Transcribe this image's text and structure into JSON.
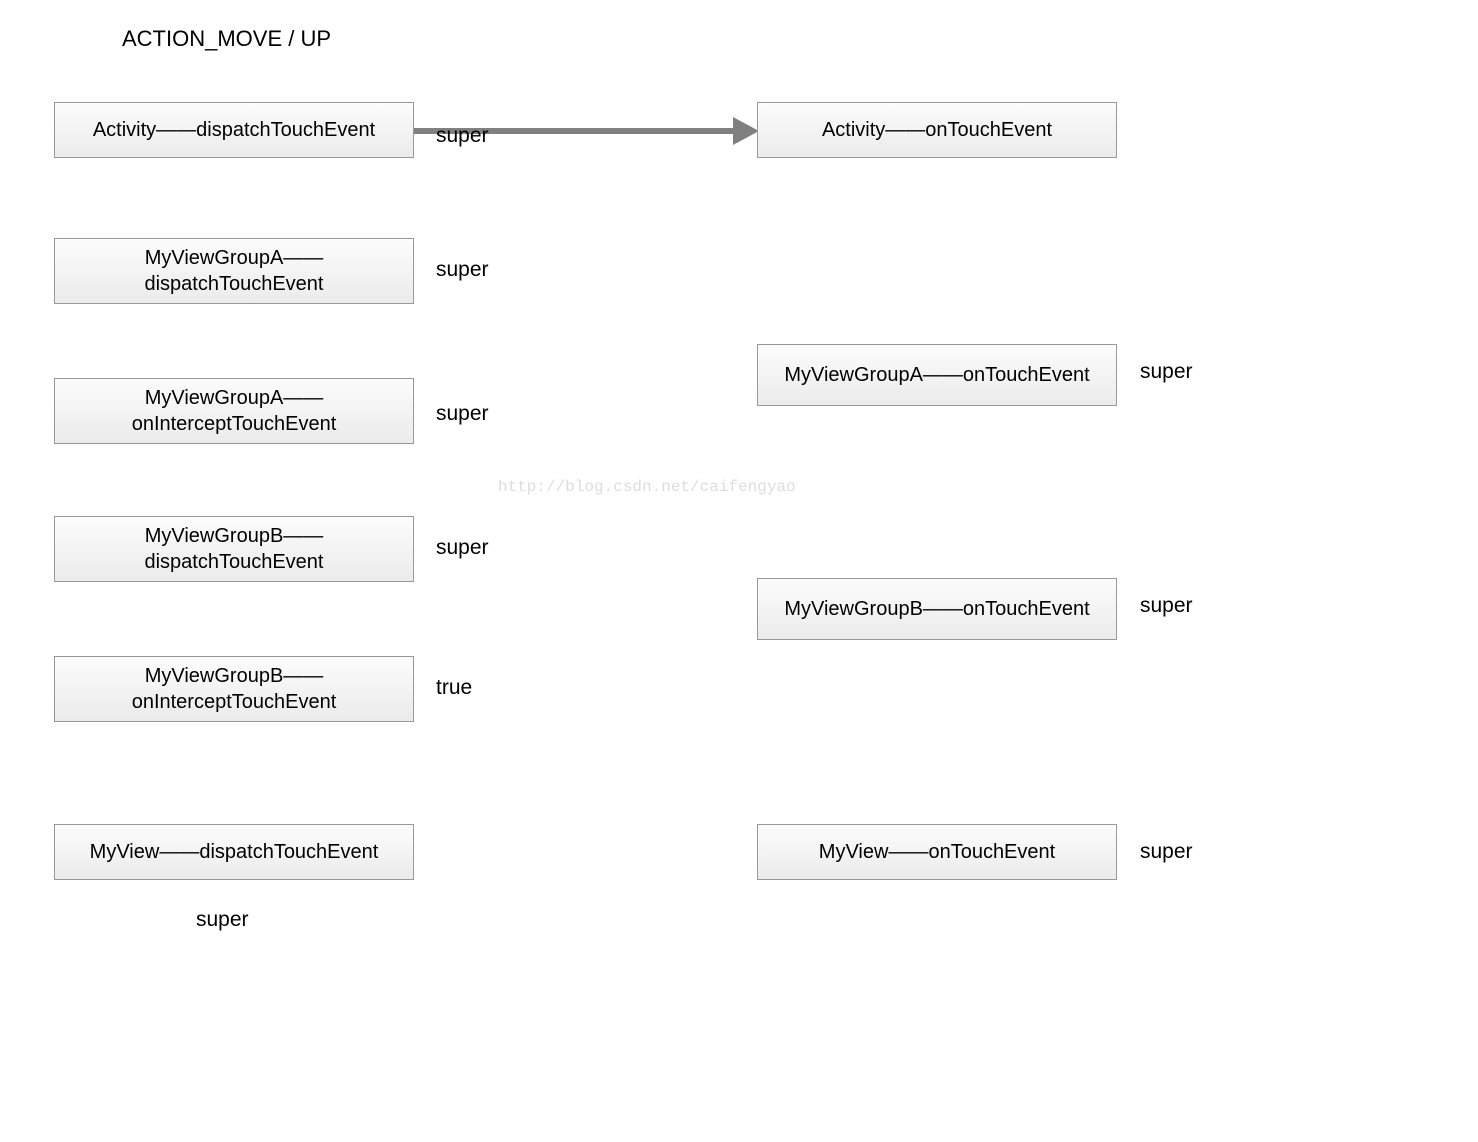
{
  "title": "ACTION_MOVE / UP",
  "watermark": "http://blog.csdn.net/caifengyao",
  "leftColumn": {
    "activity": {
      "text": "Activity——dispatchTouchEvent",
      "label": "super"
    },
    "groupADispatch": {
      "text": "MyViewGroupA——\ndispatchTouchEvent",
      "label": "super"
    },
    "groupAIntercept": {
      "text": "MyViewGroupA——\nonInterceptTouchEvent",
      "label": "super"
    },
    "groupBDispatch": {
      "text": "MyViewGroupB——\ndispatchTouchEvent",
      "label": "super"
    },
    "groupBIntercept": {
      "text": "MyViewGroupB——\nonInterceptTouchEvent",
      "label": "true"
    },
    "myViewDispatch": {
      "text": "MyView——dispatchTouchEvent",
      "label": "super"
    }
  },
  "rightColumn": {
    "activity": {
      "text": "Activity——onTouchEvent"
    },
    "groupATouch": {
      "text": "MyViewGroupA——onTouchEvent",
      "label": "super"
    },
    "groupBTouch": {
      "text": "MyViewGroupB——onTouchEvent",
      "label": "super"
    },
    "myViewTouch": {
      "text": "MyView——onTouchEvent",
      "label": "super"
    }
  }
}
